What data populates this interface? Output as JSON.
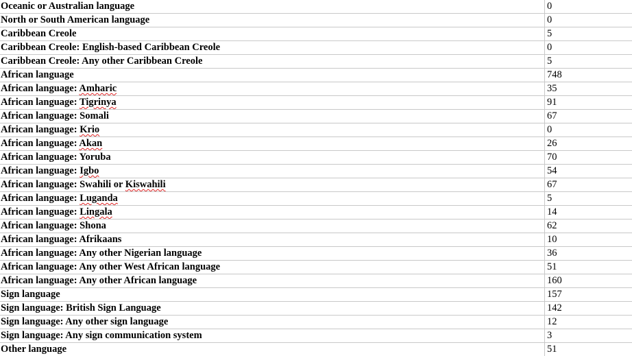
{
  "rows": [
    {
      "label": "Oceanic or Australian language",
      "value": "0"
    },
    {
      "label": "North or South American language",
      "value": "0"
    },
    {
      "label": "Caribbean Creole",
      "value": "5"
    },
    {
      "label": "Caribbean Creole: English-based Caribbean Creole",
      "value": "0"
    },
    {
      "label": "Caribbean Creole: Any other Caribbean Creole",
      "value": "5"
    },
    {
      "label": "African language",
      "value": "748"
    },
    {
      "label": "African language: ",
      "flagged": "Amharic",
      "value": "35"
    },
    {
      "label": "African language: ",
      "flagged": "Tigrinya",
      "value": "91"
    },
    {
      "label": "African language: Somali",
      "value": "67"
    },
    {
      "label": "African language: ",
      "flagged": "Krio",
      "value": "0"
    },
    {
      "label": "African language: ",
      "flagged": "Akan",
      "value": "26"
    },
    {
      "label": "African language: Yoruba",
      "value": "70"
    },
    {
      "label": "African language: ",
      "flagged": "Igbo",
      "value": "54"
    },
    {
      "label": "African language: Swahili or ",
      "flagged": "Kiswahili",
      "value": "67"
    },
    {
      "label": "African language: ",
      "flagged": "Luganda",
      "value": "5"
    },
    {
      "label": "African language: ",
      "flagged": "Lingala",
      "value": "14"
    },
    {
      "label": "African language: Shona",
      "value": "62"
    },
    {
      "label": "African language: Afrikaans",
      "value": "10"
    },
    {
      "label": "African language: Any other Nigerian language",
      "value": "36"
    },
    {
      "label": "African language: Any other West African language",
      "value": "51"
    },
    {
      "label": "African language: Any other African language",
      "value": "160"
    },
    {
      "label": "Sign language",
      "value": "157"
    },
    {
      "label": "Sign language: British Sign Language",
      "value": "142"
    },
    {
      "label": "Sign language: Any other sign language",
      "value": "12"
    },
    {
      "label": "Sign language: Any sign communication system",
      "value": "3"
    },
    {
      "label": "Other language",
      "value": "51"
    }
  ]
}
